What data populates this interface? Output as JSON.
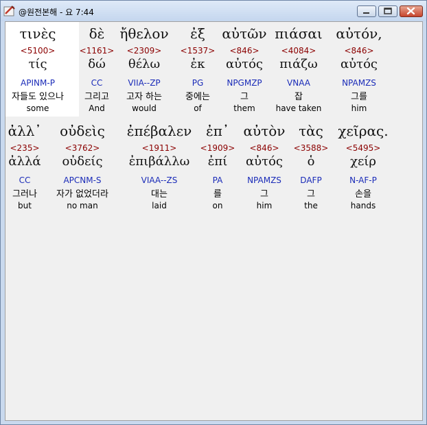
{
  "window": {
    "title": "@원전본해 - 요 7:44",
    "icon": "app-icon"
  },
  "controls": {
    "minimize": "minimize-icon",
    "maximize": "maximize-icon",
    "close": "close-icon"
  },
  "lines": [
    {
      "words": [
        {
          "greek": "τινὲς",
          "strong": "<5100>",
          "lemma": "τίς",
          "morph": "APINM-P",
          "korean": "자들도 있으나",
          "english": "some"
        },
        {
          "greek": "δὲ",
          "strong": "<1161>",
          "lemma": "δώ",
          "morph": "CC",
          "korean": "그리고",
          "english": "And"
        },
        {
          "greek": "ἤθελον",
          "strong": "<2309>",
          "lemma": "θέλω",
          "morph": "VIIA--ZP",
          "korean": "고자 하는",
          "english": "would"
        },
        {
          "greek": "ἐξ",
          "strong": "<1537>",
          "lemma": "ἐκ",
          "morph": "PG",
          "korean": "중에는",
          "english": "of"
        },
        {
          "greek": "αὐτῶν",
          "strong": "<846>",
          "lemma": "αὐτός",
          "morph": "NPGMZP",
          "korean": "그",
          "english": "them"
        },
        {
          "greek": "πιάσαι",
          "strong": "<4084>",
          "lemma": "πιάζω",
          "morph": "VNAA",
          "korean": "잡",
          "english": "have taken"
        },
        {
          "greek": "αὐτόν,",
          "strong": "<846>",
          "lemma": "αὐτός",
          "morph": "NPAMZS",
          "korean": "그를",
          "english": "him"
        }
      ]
    },
    {
      "words": [
        {
          "greek": "ἀλλ᾽",
          "strong": "<235>",
          "lemma": "ἀλλά",
          "morph": "CC",
          "korean": "그러나",
          "english": "but"
        },
        {
          "greek": "οὐδεὶς",
          "strong": "<3762>",
          "lemma": "οὐδείς",
          "morph": "APCNM-S",
          "korean": "자가 없었더라",
          "english": "no man"
        },
        {
          "greek": "ἐπέβαλεν",
          "strong": "<1911>",
          "lemma": "ἐπιβάλλω",
          "morph": "VIAA--ZS",
          "korean": "대는",
          "english": "laid"
        },
        {
          "greek": "ἐπ᾽",
          "strong": "<1909>",
          "lemma": "ἐπί",
          "morph": "PA",
          "korean": "를",
          "english": "on"
        },
        {
          "greek": "αὐτὸν",
          "strong": "<846>",
          "lemma": "αὐτός",
          "morph": "NPAMZS",
          "korean": "그",
          "english": "him"
        },
        {
          "greek": "τὰς",
          "strong": "<3588>",
          "lemma": "ὁ",
          "morph": "DAFP",
          "korean": "그",
          "english": "the"
        },
        {
          "greek": "χεῖρας.",
          "strong": "<5495>",
          "lemma": "χείρ",
          "morph": "N-AF-P",
          "korean": "손을",
          "english": "hands"
        }
      ]
    }
  ]
}
